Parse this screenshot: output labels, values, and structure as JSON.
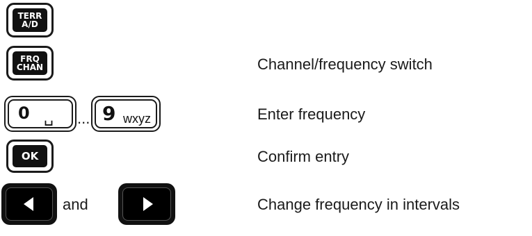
{
  "keys": {
    "terr_ad": {
      "line1": "TERR",
      "line2": "A/D"
    },
    "frq_chan": {
      "line1": "FRQ",
      "line2": "CHAN"
    },
    "num_zero": {
      "digit": "0",
      "sub": "␣"
    },
    "num_nine": {
      "digit": "9",
      "sub": "wxyz"
    },
    "range_sep": "...",
    "ok": "OK",
    "and_text": "and"
  },
  "descriptions": {
    "channel_switch": "Channel/frequency switch",
    "enter_frequency": "Enter frequency",
    "confirm_entry": "Confirm entry",
    "change_frequency": "Change frequency in intervals"
  }
}
